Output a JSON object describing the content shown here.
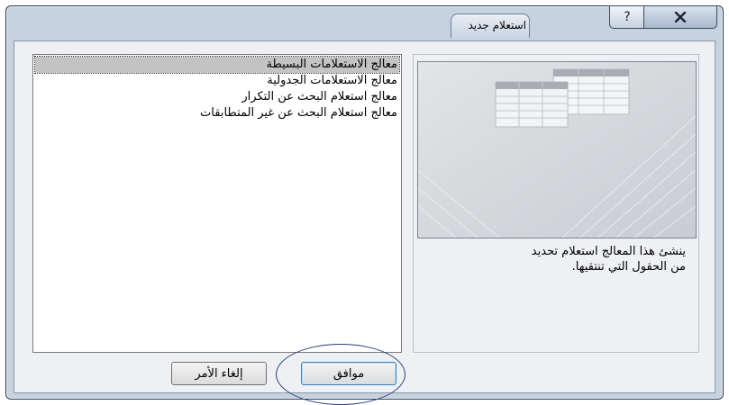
{
  "dialog": {
    "title": "استعلام جديد",
    "help_label": "?",
    "close_label": "x"
  },
  "wizard_list": {
    "items": [
      {
        "label": "معالج الاستعلامات البسيطة",
        "selected": true
      },
      {
        "label": "معالج الاستعلامات الجدولية",
        "selected": false
      },
      {
        "label": "معالج استعلام البحث عن التكرار",
        "selected": false
      },
      {
        "label": "معالج استعلام البحث عن غير المتطابقات",
        "selected": false
      }
    ]
  },
  "preview": {
    "description_line1": "ينشئ هذا المعالج استعلام تحديد",
    "description_line2": "من الحقول التي تنتقيها."
  },
  "buttons": {
    "ok": "موافق",
    "cancel": "إلغاء الأمر"
  },
  "colors": {
    "window_frame": "#c7d2e1",
    "client_bg": "#eef0f3",
    "selected_item": "#c3c3c3",
    "annotation_ellipse": "#2a3f7a"
  }
}
